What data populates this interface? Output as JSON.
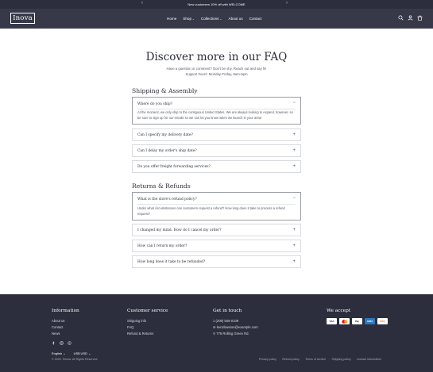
{
  "announcement": {
    "text": "New customers 10% off with WELCOME",
    "prev_icon": "chevron-left-icon",
    "next_icon": "chevron-right-icon"
  },
  "header": {
    "logo": "Inova",
    "nav": [
      {
        "label": "Home",
        "dropdown": false
      },
      {
        "label": "Shop",
        "dropdown": true
      },
      {
        "label": "Collections",
        "dropdown": true
      },
      {
        "label": "About us",
        "dropdown": false
      },
      {
        "label": "Contact",
        "dropdown": false
      }
    ],
    "icons": [
      "search-icon",
      "account-icon",
      "cart-icon"
    ]
  },
  "faq": {
    "title": "Discover more in our FAQ",
    "subtitle_1": "Have a question or comment? Don't be shy. Reach out and say hi!",
    "subtitle_2": "Support hours: Monday-Friday, 9am-5pm",
    "sections": [
      {
        "title": "Shipping & Assembly",
        "items": [
          {
            "question": "Where do you ship?",
            "open": true,
            "answer": "At the moment, we only ship to the contiguous United States. We are always looking to expand, however, so be sure to sign up for our emails so we can let you know when we launch in your area!"
          },
          {
            "question": "Can I specify my delivery date?",
            "open": false
          },
          {
            "question": "Can I delay my order's ship date?",
            "open": false
          },
          {
            "question": "Do you offer freight forwarding services?",
            "open": false
          }
        ]
      },
      {
        "title": "Returns & Refunds",
        "items": [
          {
            "question": "What is the store's refund policy?",
            "open": true,
            "answer": "Under what circumstances can customers request a refund? How long does it take to process a refund request?"
          },
          {
            "question": "I changed my mind. How do I cancel my order?",
            "open": false
          },
          {
            "question": "How can I return my order?",
            "open": false
          },
          {
            "question": "How long does it take to be refunded?",
            "open": false
          }
        ]
      }
    ],
    "open_symbol": "−",
    "closed_symbol": "+"
  },
  "footer": {
    "information": {
      "title": "Information",
      "links": [
        "About us",
        "Contact",
        "News"
      ]
    },
    "customer_service": {
      "title": "Customer service",
      "links": [
        "Shipping info",
        "FAQ",
        "Refund & Returns"
      ]
    },
    "contact": {
      "title": "Get in touch",
      "lines": [
        "1 (209) 555-0109",
        "kenzilawson@example.com",
        "775 Rolling Green Rd."
      ]
    },
    "payments": {
      "title": "We accept",
      "cards": [
        "VISA",
        "MC",
        "Pay",
        "Amex",
        "Disc"
      ]
    },
    "social_icons": [
      "facebook-icon",
      "instagram-icon",
      "pinterest-icon"
    ],
    "language": "English",
    "currency": "US$ USD",
    "copyright": "© 2025, Sirona. All Rights Reserved.",
    "legal_links": [
      "Privacy policy",
      "Refund policy",
      "Terms of service",
      "Shipping policy",
      "Contact information"
    ]
  }
}
